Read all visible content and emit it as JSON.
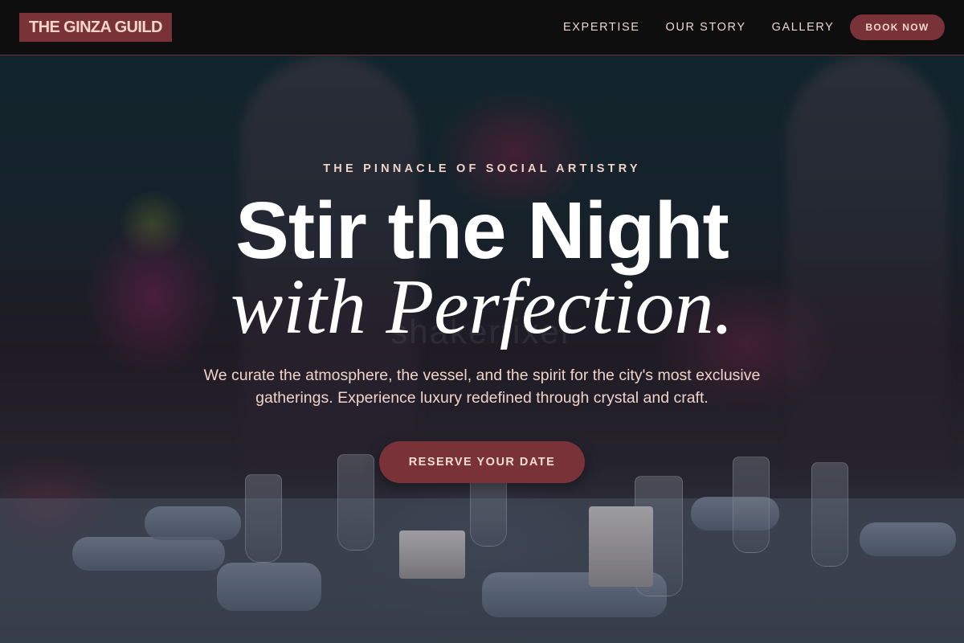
{
  "header": {
    "logo_text": "THE GINZA GUILD",
    "nav": [
      {
        "label": "EXPERTISE"
      },
      {
        "label": "OUR STORY"
      },
      {
        "label": "GALLERY"
      }
    ],
    "book_button": "BOOK NOW"
  },
  "hero": {
    "eyebrow": "THE PINNACLE OF SOCIAL ARTISTRY",
    "headline_line1": "Stir the Night",
    "headline_line2": "with Perfection.",
    "subtitle": "We curate the atmosphere, the vessel, and the spirit for the city's most exclusive gatherings. Experience luxury redefined through crystal and craft.",
    "cta": "RESERVE YOUR DATE",
    "background_image": "evening-banquet-table-photo",
    "watermark": "shakerfixer"
  },
  "colors": {
    "accent": "#7a3239",
    "accent_text": "#f3d6c9",
    "header_bg": "#0e0e0f",
    "nav_text": "#ecd6ce",
    "headline": "#ffffff"
  }
}
